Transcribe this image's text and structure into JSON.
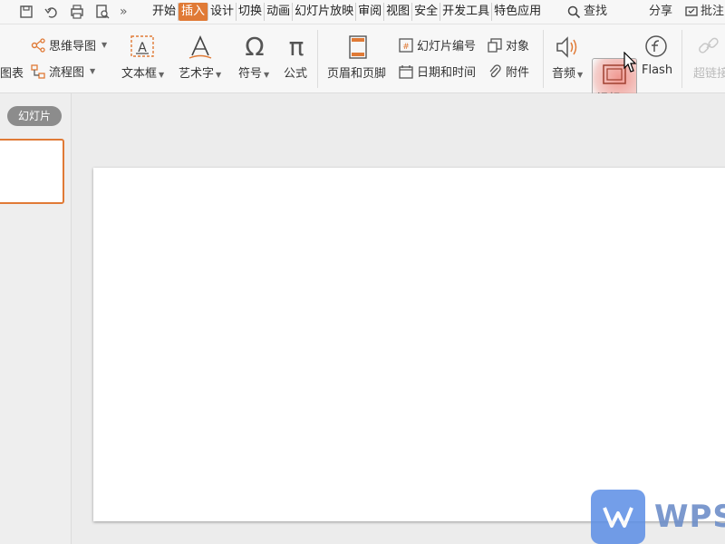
{
  "topbar": {
    "tabs": [
      "开始",
      "插入",
      "设计",
      "切换",
      "动画",
      "幻灯片放映",
      "审阅",
      "视图",
      "安全",
      "开发工具",
      "特色应用"
    ],
    "active_tab": "插入",
    "search_label": "查找",
    "share_label": "分享",
    "comment_label": "批注"
  },
  "ribbon": {
    "chart_label": "图表",
    "mindmap_label": "思维导图",
    "flowchart_label": "流程图",
    "textbox_label": "文本框",
    "wordart_label": "艺术字",
    "symbol_label": "符号",
    "formula_label": "公式",
    "header_footer_label": "页眉和页脚",
    "slide_number_label": "幻灯片编号",
    "object_label": "对象",
    "datetime_label": "日期和时间",
    "attachment_label": "附件",
    "audio_label": "音频",
    "video_label": "视频",
    "flash_label": "Flash",
    "hyperlink_label": "超链接"
  },
  "left_panel": {
    "slides_tab": "幻灯片"
  },
  "watermark": {
    "text": "WPS"
  },
  "colors": {
    "accent": "#e07a36",
    "watermark_blue": "#5b8ee6"
  }
}
